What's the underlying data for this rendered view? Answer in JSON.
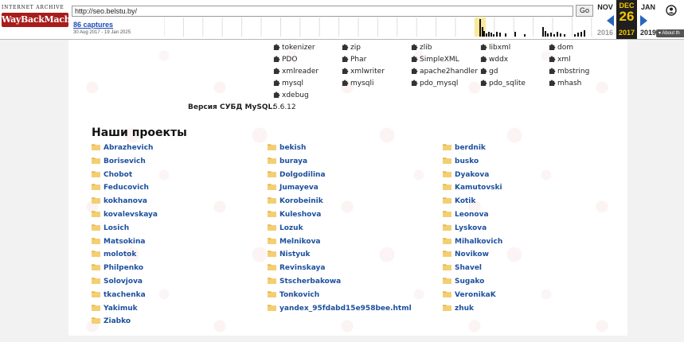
{
  "wayback": {
    "logo_top": "INTERNET ARCHIVE",
    "logo_main": "WayBackMachine",
    "url": "http://seo.belstu.by/",
    "go_label": "Go",
    "captures_label": "86 captures",
    "date_range": "30 Aug 2017 - 19 Jan 2025",
    "calendar": {
      "prev_month": "NOV",
      "prev_year": "2016",
      "cur_month": "DEC",
      "cur_day": "26",
      "cur_year": "2017",
      "next_month": "JAN",
      "next_year": "2019"
    },
    "about_label": "▾ About th",
    "icons": [
      "user-icon",
      "arrow-left-icon",
      "arrow-right-icon",
      "puzzle-icon",
      "folder-icon"
    ]
  },
  "extensions": {
    "row1": [
      "tokenizer",
      "zip",
      "zlib",
      "libxml",
      "dom"
    ],
    "row2": [
      "PDO",
      "Phar",
      "SimpleXML",
      "wddx",
      "xml"
    ],
    "row3": [
      "xmlreader",
      "xmlwriter",
      "apache2handler",
      "gd",
      "mbstring"
    ],
    "row4": [
      "mysql",
      "mysqli",
      "pdo_mysql",
      "pdo_sqlite",
      "mhash"
    ],
    "row5": [
      "xdebug"
    ]
  },
  "mysql": {
    "label": "Версия СУБД MySQL:",
    "value": "5.6.12"
  },
  "projects": {
    "title": "Наши проекты",
    "col1": [
      "Abrazhevich",
      "Borisevich",
      "Chobot",
      "Feducovich",
      "kokhanova",
      "kovalevskaya",
      "Losich",
      "Matsokina",
      "molotok",
      "Philpenko",
      "Solovjova",
      "tkachenka",
      "Yakimuk",
      "Ziabko"
    ],
    "col2": [
      "bekish",
      "buraya",
      "Dolgodilina",
      "Jumayeva",
      "Korobeinik",
      "Kuleshova",
      "Lozuk",
      "Melnikova",
      "Nistyuk",
      "Revinskaya",
      "Stscherbakowa",
      "Tonkovich",
      "yandex_95fdabd15e958bee.html"
    ],
    "col3": [
      "berdnik",
      "busko",
      "Dyakova",
      "Kamutovski",
      "Kotik",
      "Leonova",
      "Lyskova",
      "Mihalkovich",
      "Novikow",
      "Shavel",
      "Sugako",
      "VeronikaK",
      "zhuk"
    ]
  },
  "colors": {
    "link": "#1b4f9c",
    "folder": "#e8b84a",
    "wayback_red": "#a81c1c",
    "calendar_highlight": "#f7c600",
    "arrow_blue": "#2766bf"
  }
}
